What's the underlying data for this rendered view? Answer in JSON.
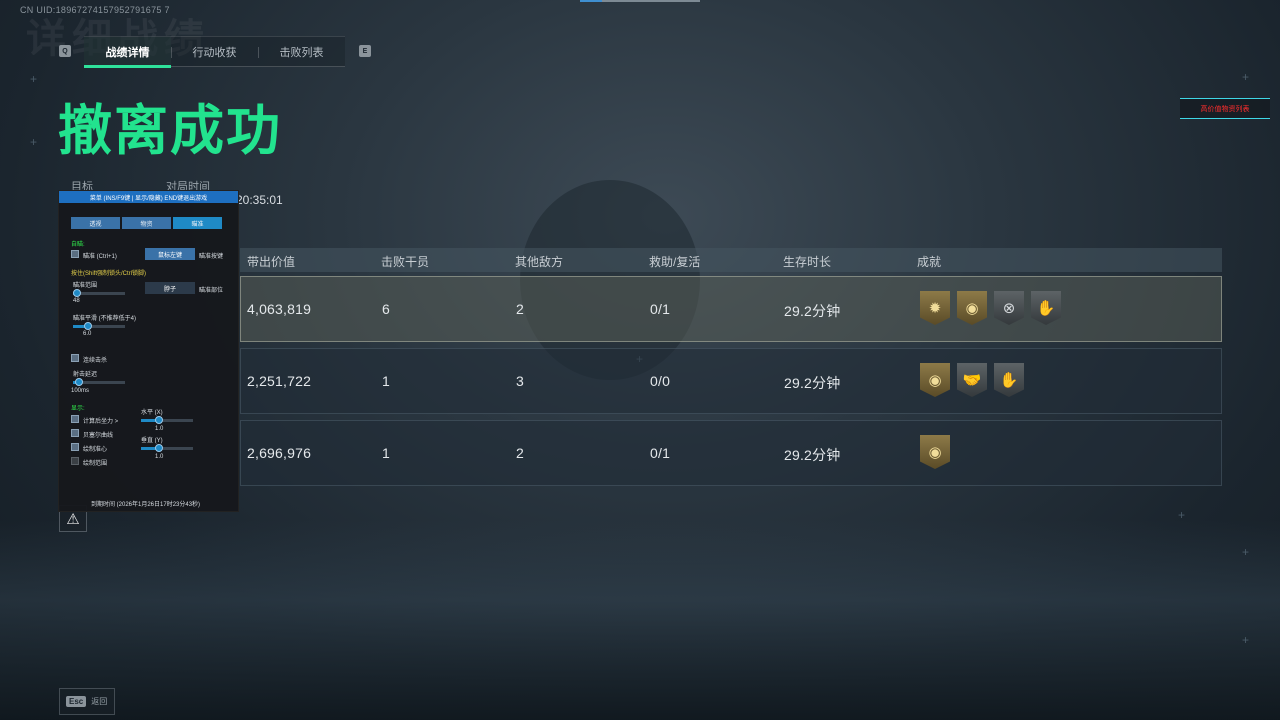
{
  "uid": "CN UID:18967274157952791675 7",
  "header": {
    "key_left": "Q",
    "key_right": "E",
    "tabs": [
      {
        "label": "战绩详情",
        "active": true
      },
      {
        "label": "行动收获",
        "active": false
      },
      {
        "label": "击败列表",
        "active": false
      }
    ]
  },
  "headline": "撤离成功",
  "high_value_button": "高价值物资列表",
  "meta": {
    "target_label": "目标",
    "duration_label": "对局时间",
    "time_value": "20:35:01"
  },
  "table": {
    "columns": [
      "带出价值",
      "击败干员",
      "其他敌方",
      "救助/复活",
      "生存时长",
      "成就"
    ],
    "rows": [
      {
        "value": "4,063,819",
        "kills": "6",
        "others": "2",
        "assist": "0/1",
        "survival": "29.2分钟",
        "highlight": true,
        "badges": [
          {
            "icon": "sunburst-badge-icon",
            "tone": "gold"
          },
          {
            "icon": "coin-badge-icon",
            "tone": "gold"
          },
          {
            "icon": "target-badge-icon",
            "tone": "grey"
          },
          {
            "icon": "hand-badge-icon",
            "tone": "grey"
          }
        ]
      },
      {
        "value": "2,251,722",
        "kills": "1",
        "others": "3",
        "assist": "0/0",
        "survival": "29.2分钟",
        "highlight": false,
        "badges": [
          {
            "icon": "coin-badge-icon",
            "tone": "gold"
          },
          {
            "icon": "handshake-badge-icon",
            "tone": "grey"
          },
          {
            "icon": "hand-badge-icon",
            "tone": "grey"
          }
        ]
      },
      {
        "value": "2,696,976",
        "kills": "1",
        "others": "2",
        "assist": "0/1",
        "survival": "29.2分钟",
        "highlight": false,
        "badges": [
          {
            "icon": "coin-badge-icon",
            "tone": "gold"
          }
        ]
      }
    ]
  },
  "footer": {
    "esc_key": "Esc",
    "esc_label": "返回"
  },
  "overlay_menu": {
    "title": "菜单 (INS/F9键 | 显示/隐藏) END键退出游戏",
    "tabs": [
      "透视",
      "物资",
      "瞄准"
    ],
    "aim_section": "自瞄:",
    "aim_toggle": "瞄准 (Ctrl+1)",
    "aim_key_button": "鼠标左键",
    "aim_key_label": "瞄准按键",
    "hold_hint": "按住(Shift强制锁头/Ctrl锁脚)",
    "range_label": "瞄准范围",
    "range_value": "48",
    "bone_button": "脖子",
    "bone_label": "瞄准部位",
    "smooth_label": "瞄准平滑 (不推荐低于4)",
    "smooth_value": "6.0",
    "burst_label": "连续击杀",
    "delay_label": "射击延迟",
    "delay_value": "100ms",
    "display_section": "显示:",
    "compensation_label": "计算后坐力 >",
    "bezier_label": "贝塞尔曲线",
    "crosshair_label": "绘制准心",
    "fov_label": "绘制范围",
    "horizontal_label": "水平 (X)",
    "horizontal_value": "1.0",
    "vertical_label": "垂直 (Y)",
    "vertical_value": "1.0",
    "expiry": "到期时间 (2026年1月26日17时23分43秒)"
  }
}
